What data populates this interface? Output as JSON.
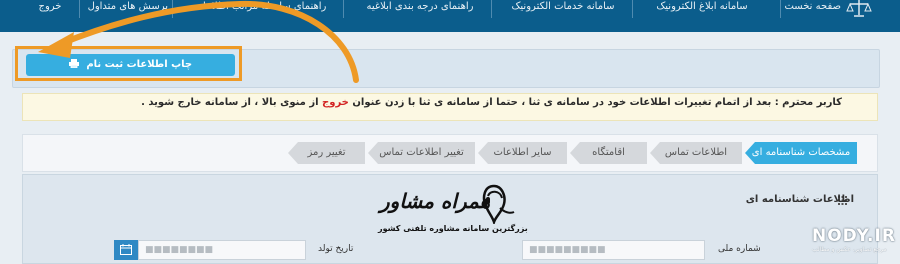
{
  "nav": {
    "items": [
      "صفحه نخست",
      "سامانه ابلاغ الکترونیک",
      "سامانه خدمات الکترونیک",
      "راهنمای درجه بندی ابلاغیه",
      "راهنمای سلسله مراتب اطلاعات",
      "پرسش های متداول",
      "خروج"
    ],
    "logo_icon": "scales-icon"
  },
  "print_button": {
    "label": "چاپ اطلاعات ثبت نام",
    "icon": "printer-icon"
  },
  "notice": {
    "text_before": "کاربر محترم : بعد از اتمام تغییرات اطلاعات خود در سامانه ی ثنا ، حتما از سامانه ی ثنا با زدن عنوان ",
    "exit_word": "خروج",
    "text_after": " از منوی بالا ، از سامانه خارج شوید ."
  },
  "steps": [
    "مشخصات شناسنامه ای",
    "اطلاعات تماس",
    "اقامتگاه",
    "سایر اطلاعات",
    "تغییر اطلاعات تماس",
    "تغییر رمز"
  ],
  "form": {
    "title": "اطلاعات شناسنامه ای",
    "title_icon": "grid-icon",
    "national_id_label": "شماره ملی",
    "birth_date_label": "تاریخ تولد",
    "national_id_value": "■■■■■■■■■",
    "birth_date_value": "■■■■■■■■",
    "calendar_icon": "calendar-icon"
  },
  "watermark": {
    "title": "همراه مشاور",
    "subtitle": "بزرگترین سامانه مشاوره تلفنی کشور"
  },
  "site_logo": {
    "name": "NODY.IR",
    "tagline": "مرجع تصاویر، عکس و مطالب"
  },
  "colors": {
    "nav_bg": "#0b5d8c",
    "accent": "#36aee0",
    "highlight": "#ee9a26",
    "notice_bg": "#fcf8e3",
    "exit_red": "#d32424"
  }
}
